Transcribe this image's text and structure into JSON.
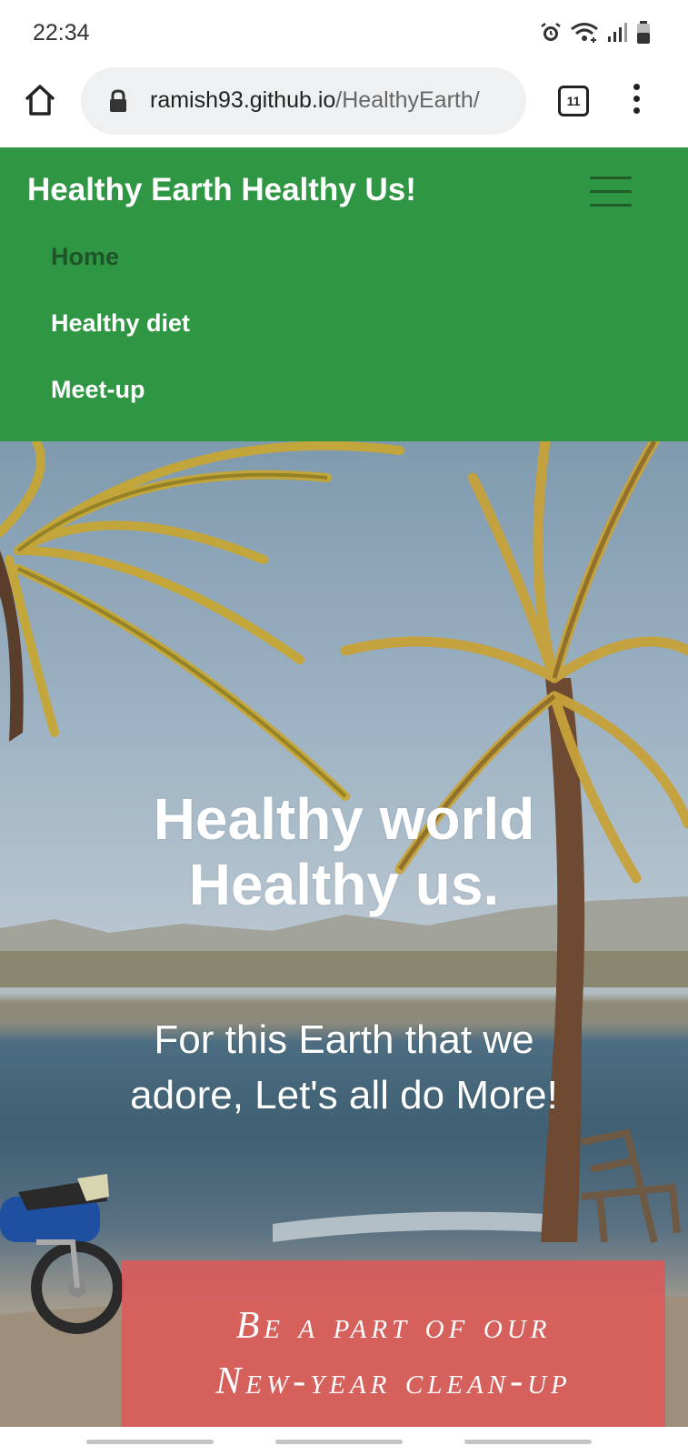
{
  "status_bar": {
    "time": "22:34",
    "icons": [
      "alarm-icon",
      "wifi-icon",
      "signal-icon",
      "battery-icon"
    ]
  },
  "browser": {
    "url_domain": "ramish93.github.io",
    "url_path": "/HealthyEarth/",
    "tab_count": "11"
  },
  "site": {
    "brand": "Healthy Earth Healthy Us!",
    "nav": [
      {
        "label": "Home",
        "active": true
      },
      {
        "label": "Healthy diet",
        "active": false
      },
      {
        "label": "Meet-up",
        "active": false
      }
    ],
    "colors": {
      "header_bg": "#2f9744",
      "nav_active": "#1e5428",
      "cta_bg": "#e25656"
    }
  },
  "hero": {
    "title_line1": "Healthy world",
    "title_line2": "Healthy us.",
    "subtitle_line1": "For this Earth that we",
    "subtitle_line2": "adore, Let's all do More!",
    "cta_line1": "Be a part of our",
    "cta_line2": "New-year clean-up"
  }
}
